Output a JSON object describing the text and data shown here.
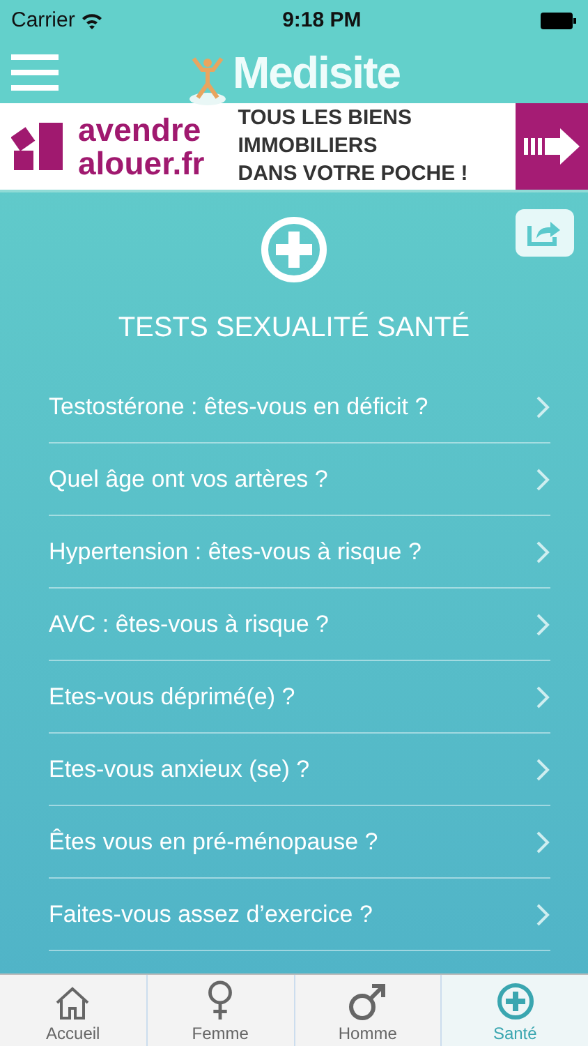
{
  "status_bar": {
    "carrier": "Carrier",
    "time": "9:18 PM"
  },
  "header": {
    "logo": "Medisite"
  },
  "ad": {
    "brand_line_1": "avendre",
    "brand_line_2": "alouer.fr",
    "text_lines": [
      "TOUS LES BIENS",
      "IMMOBILIERS",
      "DANS VOTRE POCHE !"
    ]
  },
  "section_title": "TESTS SEXUALITÉ SANTÉ",
  "tests": [
    {
      "label": "Testostérone : êtes-vous en déficit ?"
    },
    {
      "label": "Quel âge ont vos artères ?"
    },
    {
      "label": "Hypertension : êtes-vous à risque ?"
    },
    {
      "label": "AVC : êtes-vous à risque ?"
    },
    {
      "label": "Etes-vous déprimé(e) ?"
    },
    {
      "label": "Etes-vous anxieux (se) ?"
    },
    {
      "label": "Êtes vous en pré-ménopause ?"
    },
    {
      "label": "Faites-vous assez d’exercice ?"
    }
  ],
  "tab_bar": [
    {
      "kind": "home",
      "label": "Accueil",
      "selected": false
    },
    {
      "kind": "female",
      "label": "Femme",
      "selected": false
    },
    {
      "kind": "male",
      "label": "Homme",
      "selected": false
    },
    {
      "kind": "health",
      "label": "Santé",
      "selected": true
    }
  ]
}
